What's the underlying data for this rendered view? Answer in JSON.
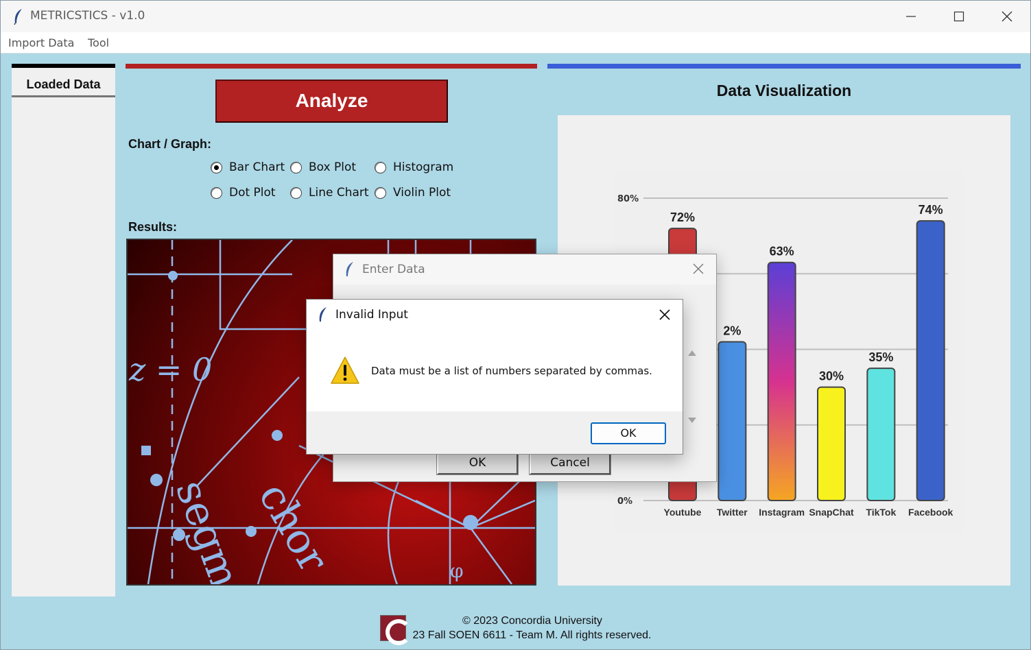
{
  "window": {
    "title": "METRICSTICS - v1.0",
    "controls": [
      "minimize",
      "maximize",
      "close"
    ]
  },
  "menu": {
    "items": [
      "Import Data",
      "Tool"
    ]
  },
  "left_panel": {
    "tab_label": "Loaded Data"
  },
  "center": {
    "analyze_label": "Analyze",
    "chart_section_label": "Chart / Graph:",
    "chart_options": [
      {
        "label": "Bar Chart",
        "selected": true
      },
      {
        "label": "Box Plot",
        "selected": false
      },
      {
        "label": "Histogram",
        "selected": false
      },
      {
        "label": "Dot Plot",
        "selected": false
      },
      {
        "label": "Line Chart",
        "selected": false
      },
      {
        "label": "Violin Plot",
        "selected": false
      }
    ],
    "results_label": "Results:",
    "results_image_text": [
      "z = 0",
      "segm",
      "chor",
      "φ"
    ]
  },
  "visualization": {
    "title": "Data Visualization"
  },
  "chart_data": {
    "type": "bar",
    "categories": [
      "Youtube",
      "Twitter",
      "Instagram",
      "SnapChat",
      "TikTok",
      "Facebook"
    ],
    "values": [
      72,
      42,
      63,
      30,
      35,
      74
    ],
    "value_labels": [
      "72%",
      "2%",
      "63%",
      "30%",
      "35%",
      "74%"
    ],
    "ylim": [
      0,
      80
    ],
    "y_ticks": [
      "80%",
      "0%"
    ],
    "grid": true,
    "colors": [
      "#c93a3a",
      "#4a90e2",
      "gradient-purple-pink-orange",
      "#f7f21e",
      "#5fe3e0",
      "#3b62c9"
    ]
  },
  "footer": {
    "line1": "© 2023 Concordia University",
    "line2": "23 Fall SOEN 6611 - Team M. All rights reserved."
  },
  "dialog_enter": {
    "title": "Enter Data",
    "ok_label": "OK",
    "cancel_label": "Cancel"
  },
  "dialog_invalid": {
    "title": "Invalid Input",
    "message": "Data must be a list of numbers separated by commas.",
    "ok_label": "OK",
    "icon": "warning-icon"
  },
  "colors": {
    "background": "#add8e6",
    "accent_red": "#b22222",
    "accent_blue": "#3a5ed8"
  }
}
